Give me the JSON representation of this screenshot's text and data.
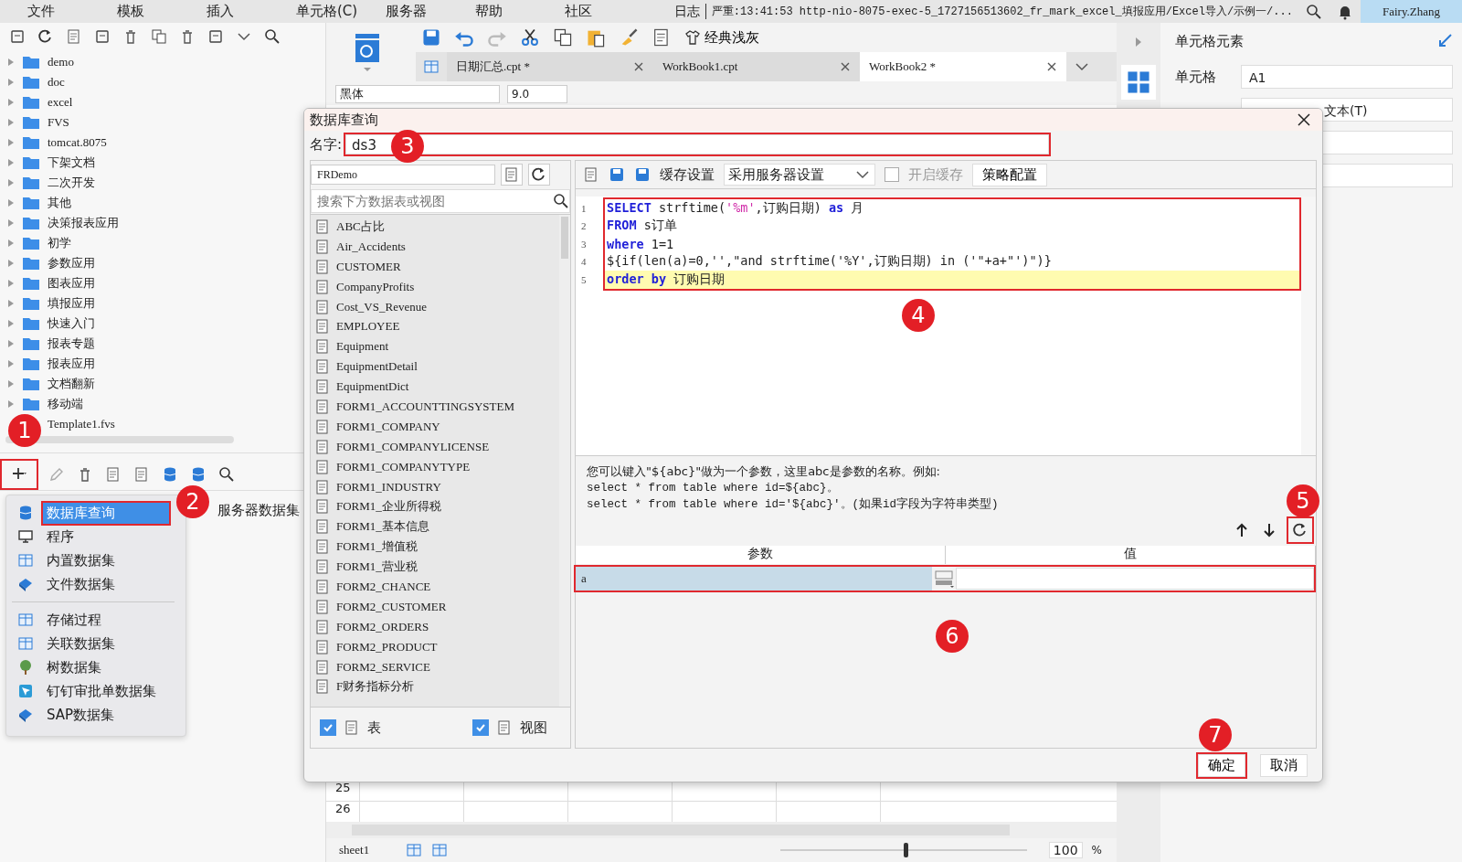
{
  "menubar": {
    "items": [
      "文件",
      "模板",
      "插入",
      "单元格(C)",
      "服务器",
      "帮助",
      "社区"
    ],
    "log": "日志",
    "log_message": "严重:13:41:53 http-nio-8075-exec-5_1727156513602_fr_mark_excel_填报应用/Excel导入/示例一/...",
    "user": "Fairy.Zhang"
  },
  "file_tree": [
    {
      "label": "demo",
      "kind": "folder"
    },
    {
      "label": "doc",
      "kind": "folder"
    },
    {
      "label": "excel",
      "kind": "folder"
    },
    {
      "label": "FVS",
      "kind": "folder"
    },
    {
      "label": "tomcat.8075",
      "kind": "folder"
    },
    {
      "label": "下架文档",
      "kind": "folder"
    },
    {
      "label": "二次开发",
      "kind": "folder"
    },
    {
      "label": "其他",
      "kind": "folder"
    },
    {
      "label": "决策报表应用",
      "kind": "folder"
    },
    {
      "label": "初学",
      "kind": "folder"
    },
    {
      "label": "参数应用",
      "kind": "folder"
    },
    {
      "label": "图表应用",
      "kind": "folder"
    },
    {
      "label": "填报应用",
      "kind": "folder"
    },
    {
      "label": "快速入门",
      "kind": "folder"
    },
    {
      "label": "报表专题",
      "kind": "folder"
    },
    {
      "label": "报表应用",
      "kind": "folder"
    },
    {
      "label": "文档翻新",
      "kind": "folder"
    },
    {
      "label": "移动端",
      "kind": "folder"
    },
    {
      "label": "Template1.fvs",
      "kind": "file"
    }
  ],
  "dataset_panel": {
    "add_button": {
      "marked": true
    },
    "server_dataset": "服务器数据集"
  },
  "new_menu": [
    [
      {
        "label": "数据库查询",
        "selected": true,
        "marked": true
      },
      {
        "label": "程序",
        "selected": false,
        "marked": false
      },
      {
        "label": "内置数据集",
        "selected": false,
        "marked": false
      },
      {
        "label": "文件数据集",
        "selected": false,
        "marked": false
      }
    ],
    [
      {
        "label": "存储过程",
        "selected": false,
        "marked": false
      },
      {
        "label": "关联数据集",
        "selected": false,
        "marked": false
      },
      {
        "label": "树数据集",
        "selected": false,
        "marked": false
      },
      {
        "label": "钉钉审批单数据集",
        "selected": false,
        "marked": false
      },
      {
        "label": "SAP数据集",
        "selected": false,
        "marked": false
      }
    ]
  ],
  "toolbar": {
    "theme_button": "经典浅灰",
    "font": "黑体",
    "font_size": "9.0"
  },
  "tabs": [
    {
      "label": "日期汇总.cpt *",
      "selected": false
    },
    {
      "label": "WorkBook1.cpt",
      "selected": false
    },
    {
      "label": "WorkBook2 *",
      "selected": true
    }
  ],
  "sheet": {
    "row_numbers": [
      "25",
      "26"
    ],
    "sheet_tab": "sheet1",
    "zoom": {
      "level": 0.5,
      "value": "100",
      "unit": "%"
    }
  },
  "right_panel": {
    "title": "单元格元素",
    "cell_label": "单元格",
    "cell_value": "A1",
    "type_value": "文本(T)"
  },
  "dialog": {
    "title": "数据库查询",
    "name_label": "名字:",
    "name_value": "ds3",
    "name_marked": true,
    "connection": "FRDemo",
    "search_placeholder": "搜索下方数据表或视图",
    "tables": [
      "ABC占比",
      "Air_Accidents",
      "CUSTOMER",
      "CompanyProfits",
      "Cost_VS_Revenue",
      "EMPLOYEE",
      "Equipment",
      "EquipmentDetail",
      "EquipmentDict",
      "FORM1_ACCOUNTTINGSYSTEM",
      "FORM1_COMPANY",
      "FORM1_COMPANYLICENSE",
      "FORM1_COMPANYTYPE",
      "FORM1_INDUSTRY",
      "FORM1_企业所得税",
      "FORM1_基本信息",
      "FORM1_增值税",
      "FORM1_营业税",
      "FORM2_CHANCE",
      "FORM2_CUSTOMER",
      "FORM2_ORDERS",
      "FORM2_PRODUCT",
      "FORM2_SERVICE",
      "F财务指标分析"
    ],
    "filters": [
      {
        "label": "表",
        "checked": true
      },
      {
        "label": "视图",
        "checked": true
      }
    ],
    "cache_label": "缓存设置",
    "cache_mode": "采用服务器设置",
    "cache_enable": {
      "label": "开启缓存",
      "checked": false,
      "disabled": true
    },
    "policy_button": "策略配置",
    "sql_marked": true,
    "sql": [
      {
        "number": "1",
        "highlighted": false,
        "tokens": [
          {
            "text": "SELECT",
            "kind": "keyword"
          },
          {
            "text": " strftime(",
            "kind": "plain"
          },
          {
            "text": "'%m'",
            "kind": "string"
          },
          {
            "text": ",订购日期) ",
            "kind": "plain"
          },
          {
            "text": "as",
            "kind": "keyword"
          },
          {
            "text": " 月",
            "kind": "plain"
          }
        ]
      },
      {
        "number": "2",
        "highlighted": false,
        "tokens": [
          {
            "text": "FROM",
            "kind": "keyword"
          },
          {
            "text": " s订单",
            "kind": "plain"
          }
        ]
      },
      {
        "number": "3",
        "highlighted": false,
        "tokens": [
          {
            "text": "where",
            "kind": "keyword"
          },
          {
            "text": " 1=1",
            "kind": "plain"
          }
        ]
      },
      {
        "number": "4",
        "highlighted": false,
        "tokens": [
          {
            "text": "${if(len(a)=0,'',\"and strftime('%Y',订购日期) in ('\"+a+\"')\")}",
            "kind": "plain"
          }
        ]
      },
      {
        "number": "5",
        "highlighted": true,
        "tokens": [
          {
            "text": "order by",
            "kind": "keyword"
          },
          {
            "text": " 订购日期",
            "kind": "plain"
          }
        ]
      }
    ],
    "hint": [
      "您可以键入\"${abc}\"做为一个参数，这里abc是参数的名称。例如:",
      "select * from table where id=${abc}。",
      "select * from table where id='${abc}'。(如果id字段为字符串类型)"
    ],
    "refresh_marked": true,
    "param_columns": [
      "参数",
      "值"
    ],
    "params": [
      {
        "name": "a",
        "selected": true,
        "marked": true
      }
    ],
    "ok_button": {
      "label": "确定",
      "marked": true
    },
    "cancel_button": "取消"
  },
  "annotations": [
    "1",
    "2",
    "3",
    "4",
    "5",
    "6",
    "7"
  ]
}
